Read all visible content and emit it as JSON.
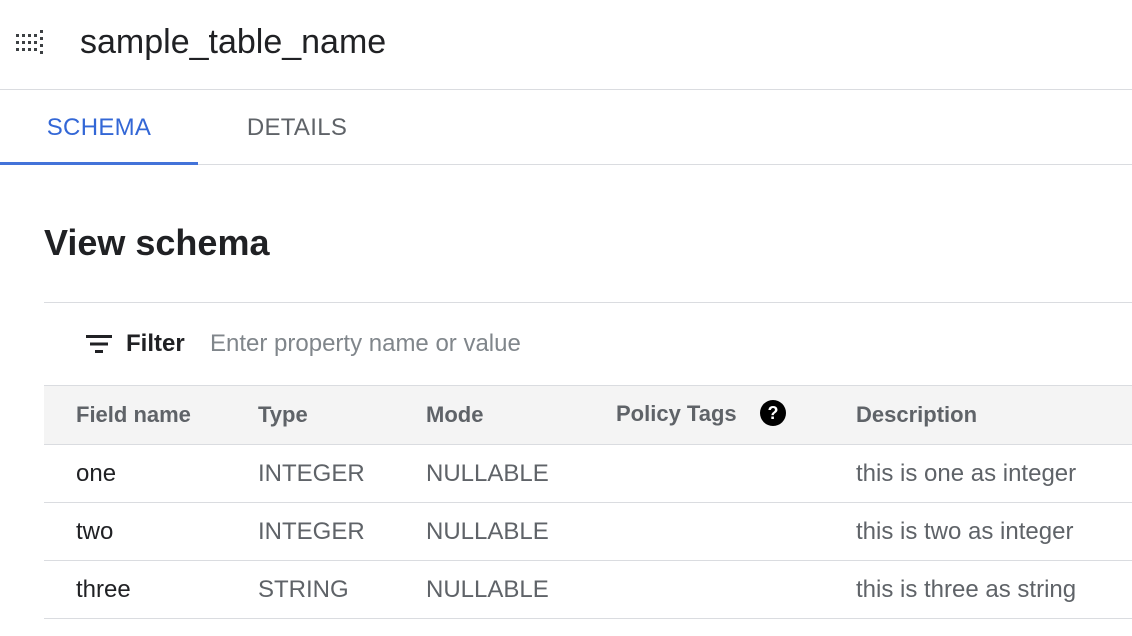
{
  "header": {
    "icon": "table-grid-icon",
    "title": "sample_table_name"
  },
  "tabs": [
    {
      "label": "SCHEMA",
      "active": true
    },
    {
      "label": "DETAILS",
      "active": false
    }
  ],
  "section": {
    "title": "View schema"
  },
  "filter": {
    "icon": "filter-icon",
    "label": "Filter",
    "placeholder": "Enter property name or value",
    "value": ""
  },
  "table": {
    "columns": [
      "Field name",
      "Type",
      "Mode",
      "Policy Tags",
      "Description"
    ],
    "help_icon": "help-question-icon",
    "rows": [
      {
        "field": "one",
        "type": "INTEGER",
        "mode": "NULLABLE",
        "policy": "",
        "description": "this is one as integer"
      },
      {
        "field": "two",
        "type": "INTEGER",
        "mode": "NULLABLE",
        "policy": "",
        "description": "this is two as integer"
      },
      {
        "field": "three",
        "type": "STRING",
        "mode": "NULLABLE",
        "policy": "",
        "description": "this is three as string"
      }
    ]
  },
  "colors": {
    "accent": "#3367d6",
    "text_primary": "#202124",
    "text_secondary": "#5f6368",
    "divider": "#dadce0",
    "header_bg": "#f4f4f4"
  }
}
